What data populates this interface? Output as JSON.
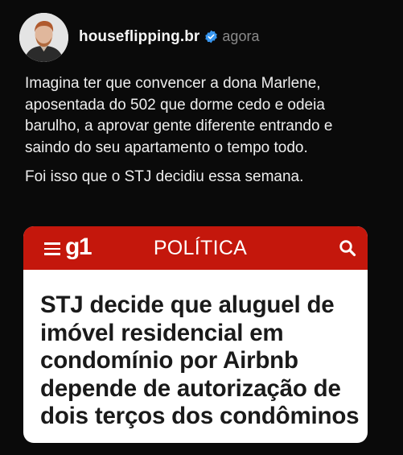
{
  "post": {
    "username": "houseflipping.br",
    "timestamp": "agora",
    "caption_paragraphs": [
      "Imagina ter que convencer a dona Marlene, aposentada do 502 que dorme cedo e odeia barulho, a aprovar gente diferente entrando e saindo do seu apartamento o tempo todo.",
      "Foi isso que o STJ decidiu essa semana."
    ],
    "avatar_icon": "profile-photo",
    "verified_icon": "verified-badge-icon",
    "verified_color": "#3897f0"
  },
  "card": {
    "logo": "g1",
    "section": "POLÍTICA",
    "headline": "STJ decide que aluguel de imóvel residencial em condomínio por Airbnb depende de autorização de dois terços dos condôminos",
    "header_color": "#c4170c",
    "menu_icon": "menu-icon",
    "search_icon": "search-icon"
  }
}
